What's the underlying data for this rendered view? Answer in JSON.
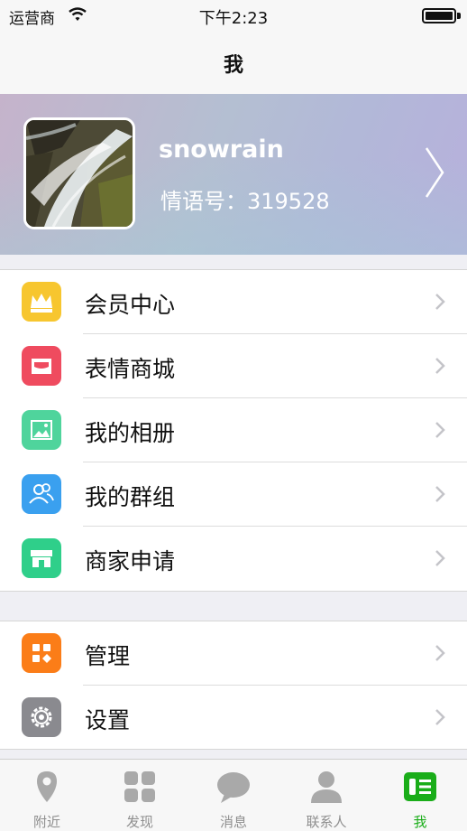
{
  "status_bar": {
    "carrier": "运营商",
    "time": "下午2:23"
  },
  "nav": {
    "title": "我"
  },
  "profile": {
    "name": "snowrain",
    "id_text": "情语号：319528"
  },
  "menu_group_1": [
    {
      "label": "会员中心",
      "icon": "crown-icon",
      "color": "#f7c62f"
    },
    {
      "label": "表情商城",
      "icon": "store-icon",
      "color": "#ef4b5f"
    },
    {
      "label": "我的相册",
      "icon": "photo-icon",
      "color": "#4fd49c"
    },
    {
      "label": "我的群组",
      "icon": "group-icon",
      "color": "#3aa0ef"
    },
    {
      "label": "商家申请",
      "icon": "shop-icon",
      "color": "#2fcf8a"
    }
  ],
  "menu_group_2": [
    {
      "label": "管理",
      "icon": "grid-icon",
      "color": "#fb7d18"
    },
    {
      "label": "设置",
      "icon": "gear-icon",
      "color": "#8a8a8f"
    }
  ],
  "tabs": [
    {
      "label": "附近",
      "icon": "location-pin-icon"
    },
    {
      "label": "发现",
      "icon": "discover-grid-icon"
    },
    {
      "label": "消息",
      "icon": "chat-bubble-icon"
    },
    {
      "label": "联系人",
      "icon": "person-icon"
    },
    {
      "label": "我",
      "icon": "me-card-icon",
      "active": true
    }
  ],
  "colors": {
    "active_tab": "#1aad19",
    "inactive_tab": "#8f8f8f"
  }
}
